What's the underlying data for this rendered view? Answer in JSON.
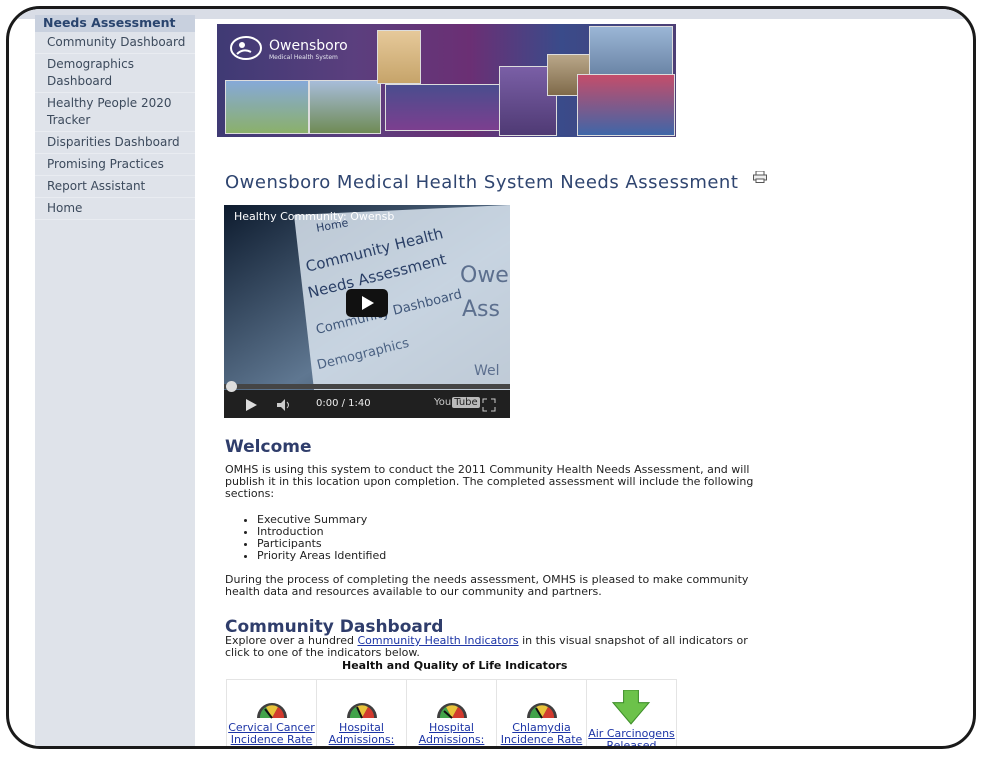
{
  "sidebar": {
    "heading": "Needs Assessment",
    "items": [
      {
        "label": "Community Dashboard"
      },
      {
        "label": "Demographics Dashboard"
      },
      {
        "label": "Healthy People 2020 Tracker"
      },
      {
        "label": "Disparities Dashboard"
      },
      {
        "label": "Promising Practices"
      },
      {
        "label": "Report Assistant"
      },
      {
        "label": "Home"
      }
    ]
  },
  "banner": {
    "logo_text": "Owensboro",
    "logo_sub": "Medical Health System"
  },
  "page_title": "Owensboro Medical Health System Needs Assessment",
  "video": {
    "title": "Healthy Community: Owensb",
    "time": "0:00 / 1:40",
    "brand": "You",
    "brand_box": "Tube",
    "screen_lines": [
      "Home",
      "Community Health",
      "Needs Assessment",
      "Community Dashboard",
      "Demographics",
      "Owe",
      "Ass",
      "Wel"
    ]
  },
  "welcome": {
    "heading": "Welcome",
    "para1": "OMHS is using this system to conduct the 2011 Community Health Needs Assessment, and will publish it in this location upon completion. The completed assessment will include the following sections:",
    "bullets": [
      "Executive Summary",
      "Introduction",
      "Participants",
      "Priority Areas Identified"
    ],
    "para2": "During the process of completing the needs assessment, OMHS is pleased to make community health data and resources available to our community and partners."
  },
  "community_dashboard": {
    "heading": "Community Dashboard",
    "text_before": "Explore over a hundred ",
    "link": "Community Health Indicators",
    "text_after": " in this visual snapshot of all indicators or click to one of the indicators below.",
    "table_title": "Health and Quality of Life Indicators",
    "indicators": [
      {
        "label": "Cervical Cancer Incidence Rate",
        "icon": "gauge-icon"
      },
      {
        "label": "Hospital Admissions: Adult Asthma",
        "icon": "gauge-icon"
      },
      {
        "label": "Hospital Admissions: COPD",
        "icon": "gauge-icon"
      },
      {
        "label": "Chlamydia Incidence Rate",
        "icon": "gauge-icon"
      },
      {
        "label": "Air Carcinogens Released",
        "icon": "down-arrow-icon"
      }
    ]
  }
}
